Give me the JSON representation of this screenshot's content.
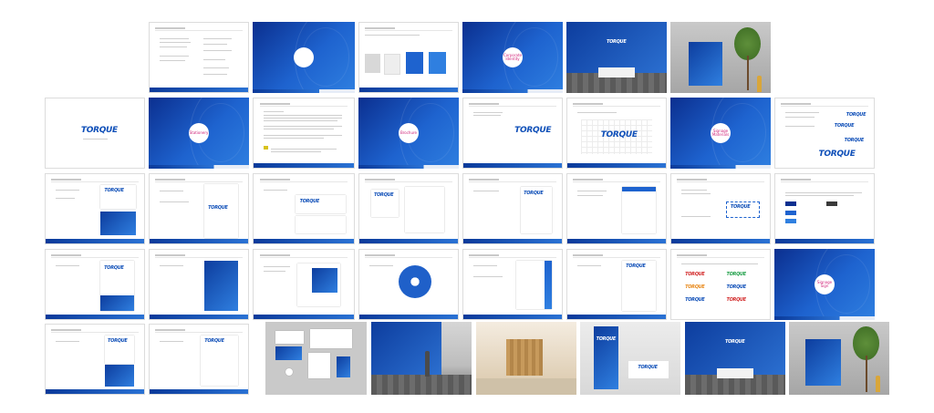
{
  "circle_labels": {
    "r0c3": "Corporate Identity",
    "r1c1": "Stationery",
    "r1c3": "Brochure",
    "r1c7": "Signage Materials",
    "r3c8": "Signage Sign"
  },
  "logo_text": "TORQUE",
  "colors": {
    "brand_blue": "#1e63cf",
    "dark_blue": "#0b2f8f",
    "accent_pink": "#d0247a"
  }
}
